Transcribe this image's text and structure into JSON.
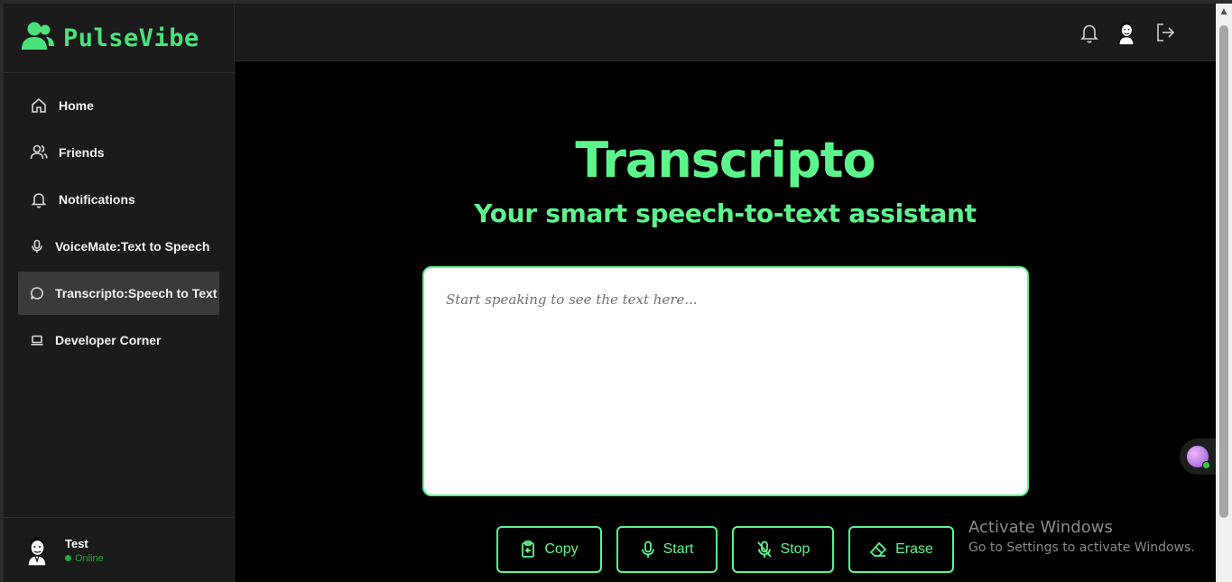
{
  "app": {
    "brand": "PulseVibe",
    "accent_color": "#5cf58c",
    "brand_icon": "users-icon"
  },
  "sidebar": {
    "items": [
      {
        "label": "Home",
        "icon": "home-icon"
      },
      {
        "label": "Friends",
        "icon": "users-icon"
      },
      {
        "label": "Notifications",
        "icon": "bell-icon"
      },
      {
        "label": "VoiceMate:Text to Speech",
        "icon": "microphone-icon"
      },
      {
        "label": "Transcripto:Speech to Text",
        "icon": "chat-bubble-icon",
        "active": true
      },
      {
        "label": "Developer Corner",
        "icon": "laptop-icon"
      }
    ],
    "user": {
      "name": "Test",
      "status": "Online",
      "status_color": "#1faa3c"
    }
  },
  "topbar": {
    "icons": [
      "bell-icon",
      "avatar",
      "logout-icon"
    ]
  },
  "main": {
    "title": "Transcripto",
    "subtitle": "Your smart speech-to-text assistant",
    "textarea": {
      "placeholder": "Start speaking to see the text here...",
      "value": ""
    },
    "buttons": {
      "copy": "Copy",
      "start": "Start",
      "stop": "Stop",
      "erase": "Erase"
    }
  },
  "watermark": {
    "line1": "Activate Windows",
    "line2": "Go to Settings to activate Windows."
  }
}
